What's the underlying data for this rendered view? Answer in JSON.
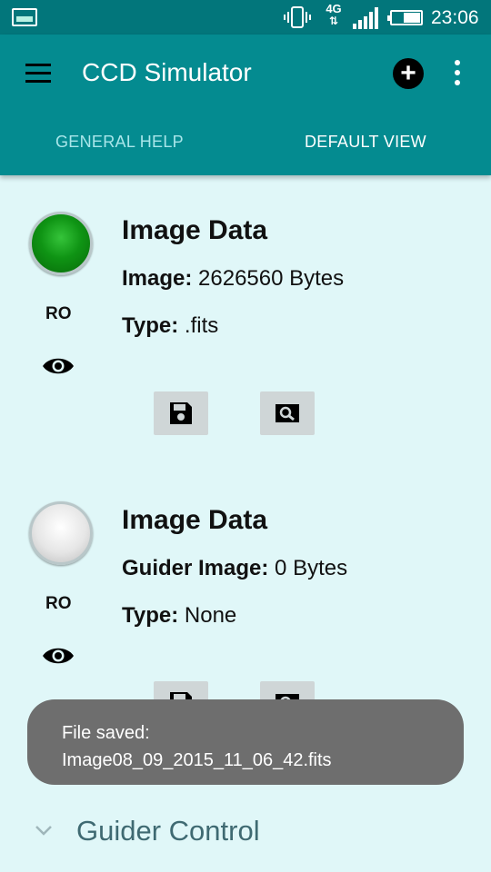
{
  "status_bar": {
    "network": "4G",
    "time": "23:06",
    "battery_level": 0.55
  },
  "app_bar": {
    "title": "CCD Simulator"
  },
  "tabs": [
    {
      "label": "GENERAL HELP"
    },
    {
      "label": "DEFAULT VIEW"
    }
  ],
  "cards": [
    {
      "title": "Image Data",
      "permission": "RO",
      "led_state": "ok",
      "line1_label": "Image:",
      "line1_value": "2626560 Bytes",
      "line2_label": "Type:",
      "line2_value": ".fits"
    },
    {
      "title": "Image Data",
      "permission": "RO",
      "led_state": "idle",
      "line1_label": "Guider Image:",
      "line1_value": "0 Bytes",
      "line2_label": "Type:",
      "line2_value": "None"
    }
  ],
  "toast": {
    "line1": "File saved:",
    "line2": "Image08_09_2015_11_06_42.fits"
  },
  "section": {
    "title": "Guider Control"
  },
  "colors": {
    "status_bar": "#02767b",
    "app_bar": "#048b90",
    "background": "#e0f7f8",
    "led_green": "#0f9414",
    "toast": "#6e6e6e"
  }
}
